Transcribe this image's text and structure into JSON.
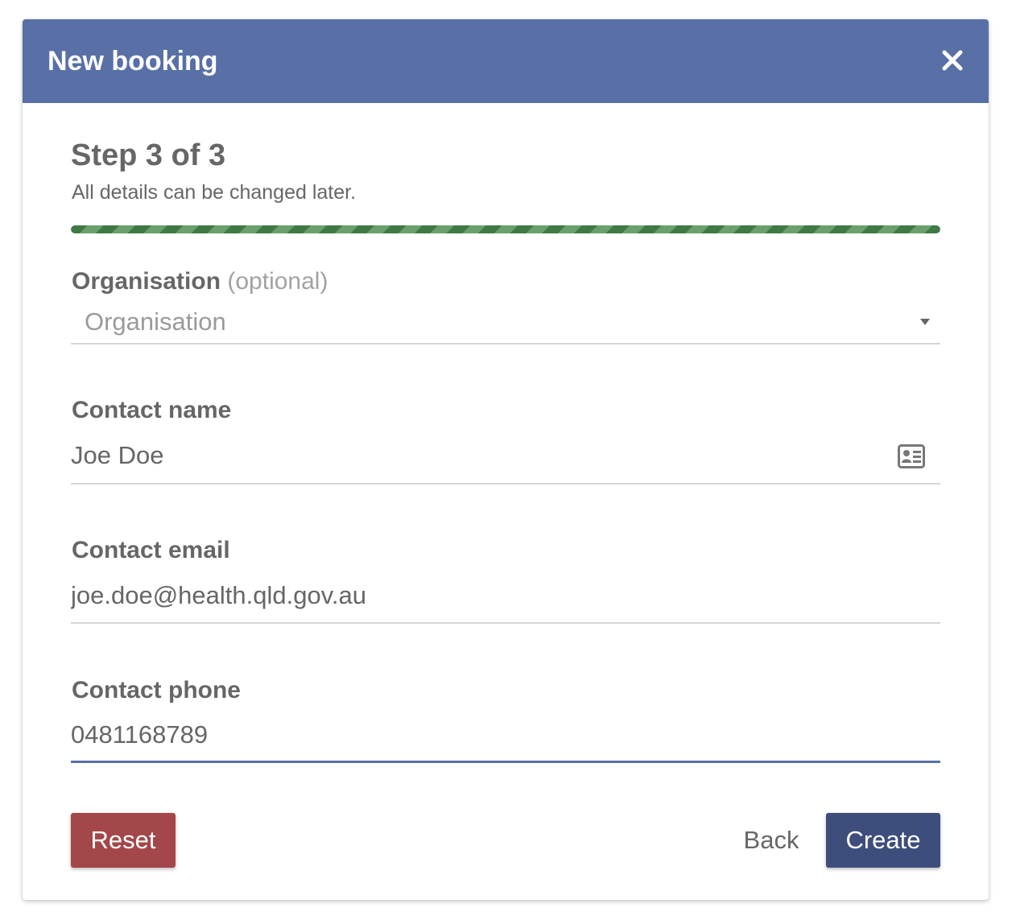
{
  "dialog": {
    "title": "New booking",
    "close_icon": "close-icon"
  },
  "step": {
    "title": "Step 3 of 3",
    "subtitle": "All details can be changed later.",
    "progress": 1.0
  },
  "organisation": {
    "label": "Organisation",
    "optional_label": "(optional)",
    "placeholder": "Organisation",
    "dropdown_icon": "chevron-down-icon"
  },
  "contact_name": {
    "label": "Contact name",
    "value": "Joe Doe",
    "icon": "contact-card-icon"
  },
  "contact_email": {
    "label": "Contact email",
    "value": "joe.doe@health.qld.gov.au"
  },
  "contact_phone": {
    "label": "Contact phone",
    "value": "0481168789"
  },
  "actions": {
    "reset_label": "Reset",
    "back_label": "Back",
    "create_label": "Create"
  },
  "colors": {
    "header": "#5870a6",
    "progress": "#4c8a52",
    "reset": "#a4474a",
    "create": "#3e4e7c",
    "active_underline": "#5870a6"
  }
}
